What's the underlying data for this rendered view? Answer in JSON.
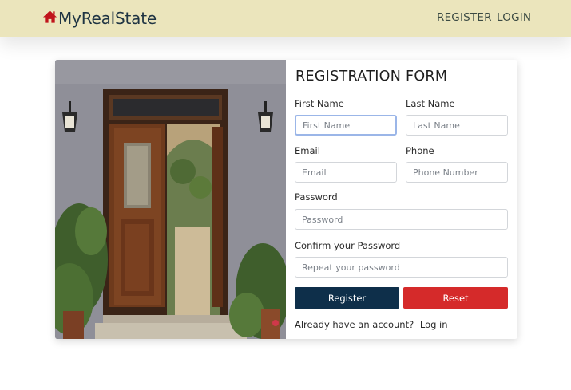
{
  "nav": {
    "brand": "MyRealState",
    "links": {
      "register": "REGISTER",
      "login": "LOGIN"
    },
    "brand_icon": "home-icon",
    "colors": {
      "bar": "#ebe5bc",
      "brand_icon": "#c0141b",
      "brand_text": "#1f3443"
    }
  },
  "form": {
    "title": "REGISTRATION FORM",
    "fields": {
      "first_name": {
        "label": "First Name",
        "placeholder": "First Name",
        "value": ""
      },
      "last_name": {
        "label": "Last Name",
        "placeholder": "Last Name",
        "value": ""
      },
      "email": {
        "label": "Email",
        "placeholder": "Email",
        "value": ""
      },
      "phone": {
        "label": "Phone",
        "placeholder": "Phone Number",
        "value": ""
      },
      "password": {
        "label": "Password",
        "placeholder": "Password",
        "value": ""
      },
      "confirm_password": {
        "label": "Confirm your Password",
        "placeholder": "Repeat your password",
        "value": ""
      }
    },
    "buttons": {
      "register": "Register",
      "reset": "Reset"
    },
    "footer": {
      "text": "Already have an account?",
      "link": "Log in"
    },
    "colors": {
      "register_button": "#0e2f4a",
      "reset_button": "#d52a2a"
    }
  }
}
